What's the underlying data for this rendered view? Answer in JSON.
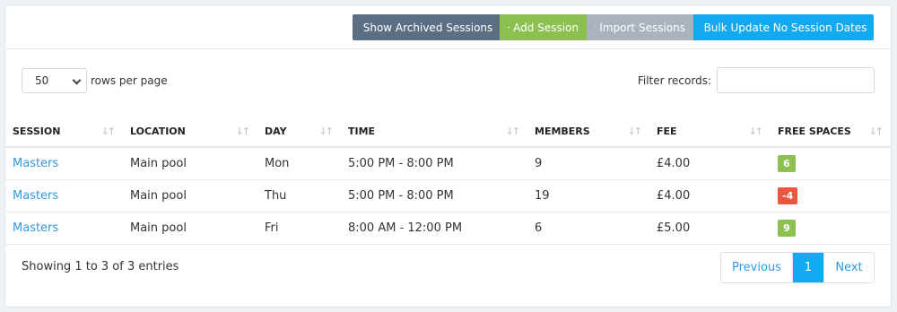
{
  "toolbar": {
    "archived": {
      "label": "Show Archived Sessions",
      "icon": "eye-icon"
    },
    "add": {
      "label": "Add Session",
      "icon": "plus-icon"
    },
    "import": {
      "label": "Import Sessions",
      "icon": "upload-icon"
    },
    "bulk": {
      "label": "Bulk Update No Session Dates",
      "icon": "edit-icon"
    }
  },
  "controls": {
    "page_length": "50",
    "page_length_label": "rows per page",
    "filter_label": "Filter records:",
    "filter_value": ""
  },
  "table": {
    "headers": [
      "SESSION",
      "LOCATION",
      "DAY",
      "TIME",
      "MEMBERS",
      "FEE",
      "FREE SPACES"
    ],
    "rows": [
      {
        "session": "Masters",
        "location": "Main pool",
        "day": "Mon",
        "time": "5:00 PM - 8:00 PM",
        "members": "9",
        "fee": "£4.00",
        "free": "6",
        "free_color": "#8cc152"
      },
      {
        "session": "Masters",
        "location": "Main pool",
        "day": "Thu",
        "time": "5:00 PM - 8:00 PM",
        "members": "19",
        "fee": "£4.00",
        "free": "-4",
        "free_color": "#e9573f"
      },
      {
        "session": "Masters",
        "location": "Main pool",
        "day": "Fri",
        "time": "8:00 AM - 12:00 PM",
        "members": "6",
        "fee": "£5.00",
        "free": "9",
        "free_color": "#8cc152"
      }
    ]
  },
  "footer": {
    "info": "Showing 1 to 3 of 3 entries",
    "previous": "Previous",
    "current_page": "1",
    "next": "Next"
  }
}
